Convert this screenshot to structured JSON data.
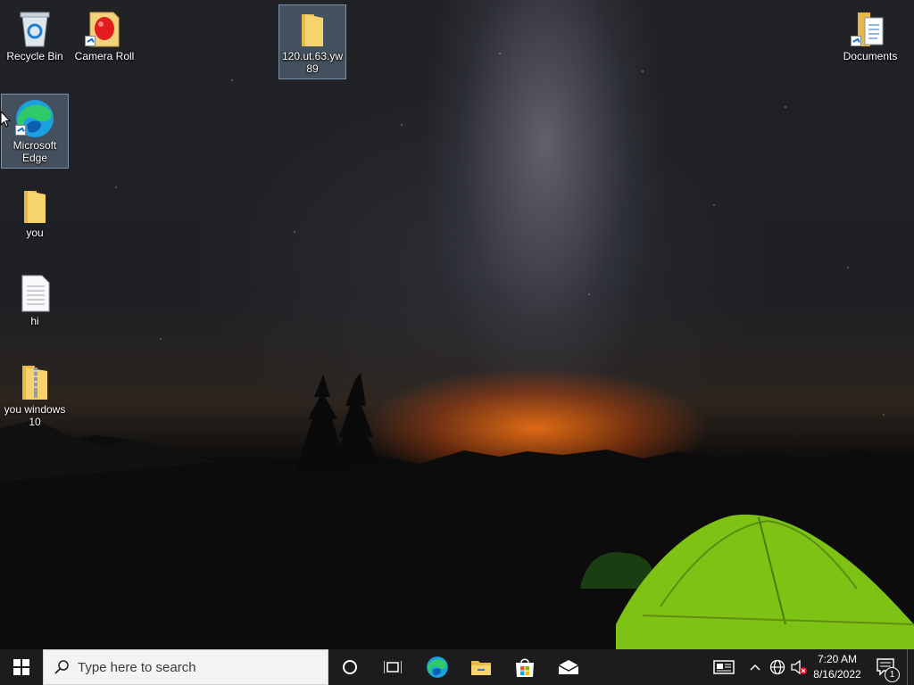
{
  "desktop": {
    "icons": [
      {
        "label": "Recycle Bin",
        "icon": "recycle-bin-icon"
      },
      {
        "label": "Camera Roll",
        "icon": "camera-roll-folder-icon"
      },
      {
        "label": "120.ut.63.yw89",
        "icon": "folder-icon",
        "selected": true
      },
      {
        "label": "Documents",
        "icon": "documents-folder-icon"
      },
      {
        "label": "Microsoft Edge",
        "icon": "edge-icon",
        "selected": true
      },
      {
        "label": "you",
        "icon": "folder-icon"
      },
      {
        "label": "hi",
        "icon": "text-document-icon"
      },
      {
        "label": "you windows 10",
        "icon": "zip-folder-icon"
      }
    ]
  },
  "taskbar": {
    "search": {
      "placeholder": "Type here to search"
    },
    "pinned": [
      "cortana-icon",
      "task-view-icon",
      "edge-icon",
      "file-explorer-icon",
      "store-icon",
      "mail-icon"
    ],
    "tray": {
      "time": "7:20 AM",
      "date": "8/16/2022",
      "notification_count": "1"
    }
  }
}
